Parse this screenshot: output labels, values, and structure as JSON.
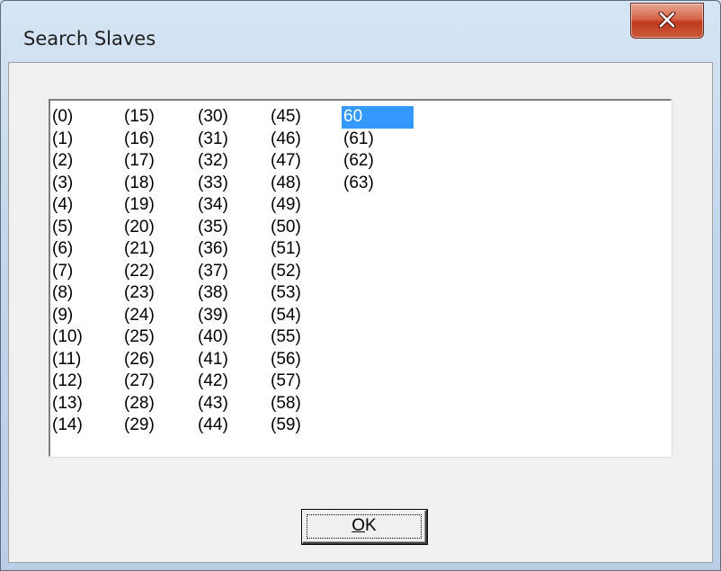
{
  "window": {
    "title": "Search Slaves",
    "close_icon": "close-x"
  },
  "listbox": {
    "columns": [
      [
        "(0)",
        "(1)",
        "(2)",
        "(3)",
        "(4)",
        "(5)",
        "(6)",
        "(7)",
        "(8)",
        "(9)",
        "(10)",
        "(11)",
        "(12)",
        "(13)",
        "(14)"
      ],
      [
        "(15)",
        "(16)",
        "(17)",
        "(18)",
        "(19)",
        "(20)",
        "(21)",
        "(22)",
        "(23)",
        "(24)",
        "(25)",
        "(26)",
        "(27)",
        "(28)",
        "(29)"
      ],
      [
        "(30)",
        "(31)",
        "(32)",
        "(33)",
        "(34)",
        "(35)",
        "(36)",
        "(37)",
        "(38)",
        "(39)",
        "(40)",
        "(41)",
        "(42)",
        "(43)",
        "(44)"
      ],
      [
        "(45)",
        "(46)",
        "(47)",
        "(48)",
        "(49)",
        "(50)",
        "(51)",
        "(52)",
        "(53)",
        "(54)",
        "(55)",
        "(56)",
        "(57)",
        "(58)",
        "(59)"
      ],
      [
        "60",
        "(61)",
        "(62)",
        "(63)"
      ]
    ],
    "selected": "60",
    "selection_color": "#3399ff"
  },
  "ok_button": {
    "mnemonic": "O",
    "rest": "K"
  }
}
